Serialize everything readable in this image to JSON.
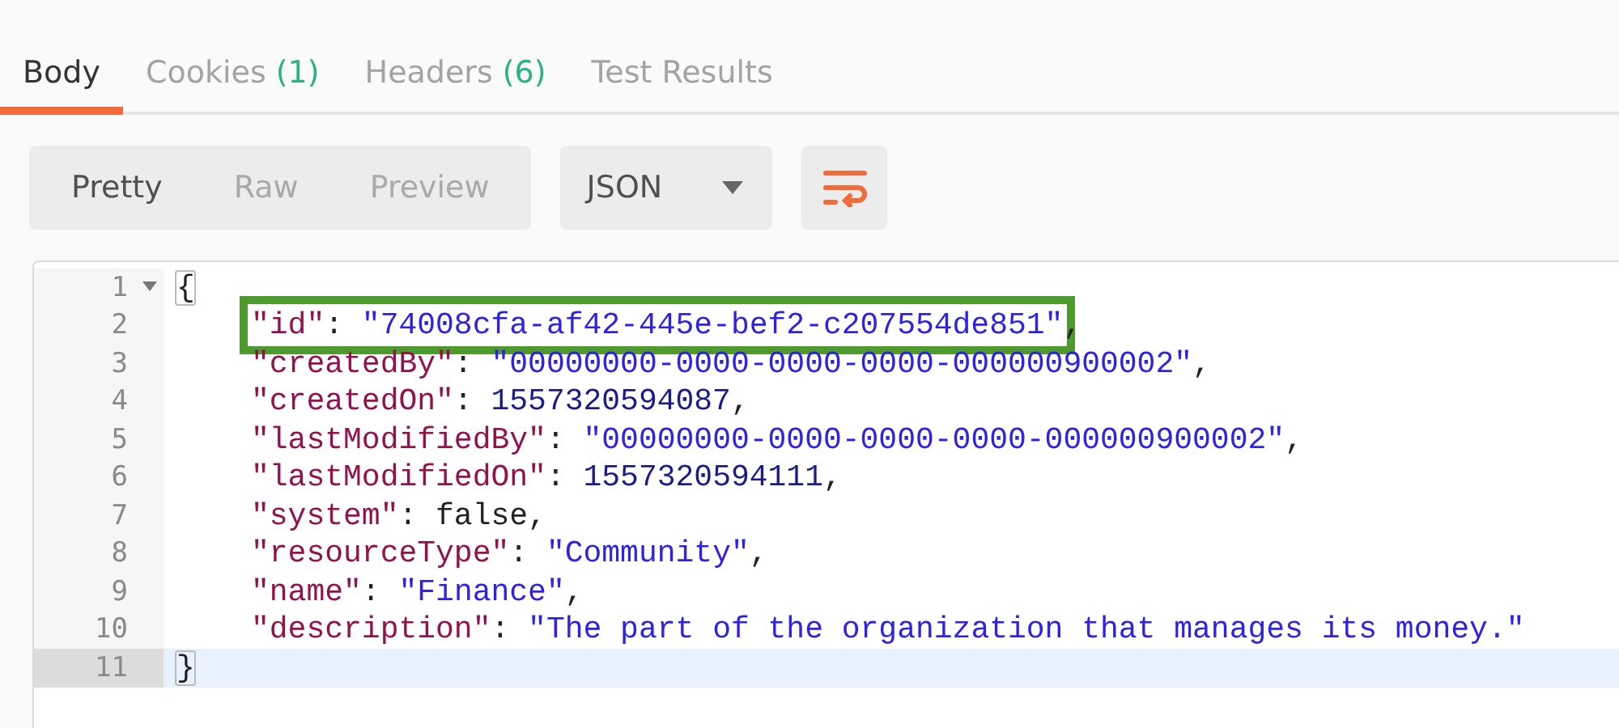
{
  "tabs": [
    {
      "label": "Body",
      "selected": true
    },
    {
      "label": "Cookies",
      "count": "(1)",
      "selected": false
    },
    {
      "label": "Headers",
      "count": "(6)",
      "selected": false
    },
    {
      "label": "Test Results",
      "selected": false
    }
  ],
  "view_modes": [
    {
      "label": "Pretty",
      "selected": true
    },
    {
      "label": "Raw",
      "selected": false
    },
    {
      "label": "Preview",
      "selected": false
    }
  ],
  "format_dropdown": {
    "value": "JSON"
  },
  "wrap_button": {
    "on": true
  },
  "editor": {
    "lines": [
      {
        "number": "1",
        "kind": "brace",
        "foldable": true,
        "current": false,
        "highlighted": false,
        "tokens": [
          {
            "kind": "punct",
            "text": "{"
          }
        ]
      },
      {
        "number": "2",
        "kind": "member",
        "foldable": false,
        "current": false,
        "highlighted": true,
        "tokens": [
          {
            "kind": "key",
            "text": "\"id\""
          },
          {
            "kind": "punct",
            "text": ": "
          },
          {
            "kind": "string",
            "text": "\"74008cfa-af42-445e-bef2-c207554de851\""
          },
          {
            "kind": "punct",
            "text": ","
          }
        ]
      },
      {
        "number": "3",
        "kind": "member",
        "foldable": false,
        "current": false,
        "highlighted": false,
        "tokens": [
          {
            "kind": "key",
            "text": "\"createdBy\""
          },
          {
            "kind": "punct",
            "text": ": "
          },
          {
            "kind": "string",
            "text": "\"00000000-0000-0000-0000-000000900002\""
          },
          {
            "kind": "punct",
            "text": ","
          }
        ]
      },
      {
        "number": "4",
        "kind": "member",
        "foldable": false,
        "current": false,
        "highlighted": false,
        "tokens": [
          {
            "kind": "key",
            "text": "\"createdOn\""
          },
          {
            "kind": "punct",
            "text": ": "
          },
          {
            "kind": "number",
            "text": "1557320594087"
          },
          {
            "kind": "punct",
            "text": ","
          }
        ]
      },
      {
        "number": "5",
        "kind": "member",
        "foldable": false,
        "current": false,
        "highlighted": false,
        "tokens": [
          {
            "kind": "key",
            "text": "\"lastModifiedBy\""
          },
          {
            "kind": "punct",
            "text": ": "
          },
          {
            "kind": "string",
            "text": "\"00000000-0000-0000-0000-000000900002\""
          },
          {
            "kind": "punct",
            "text": ","
          }
        ]
      },
      {
        "number": "6",
        "kind": "member",
        "foldable": false,
        "current": false,
        "highlighted": false,
        "tokens": [
          {
            "kind": "key",
            "text": "\"lastModifiedOn\""
          },
          {
            "kind": "punct",
            "text": ": "
          },
          {
            "kind": "number",
            "text": "1557320594111"
          },
          {
            "kind": "punct",
            "text": ","
          }
        ]
      },
      {
        "number": "7",
        "kind": "member",
        "foldable": false,
        "current": false,
        "highlighted": false,
        "tokens": [
          {
            "kind": "key",
            "text": "\"system\""
          },
          {
            "kind": "punct",
            "text": ": "
          },
          {
            "kind": "boolean",
            "text": "false"
          },
          {
            "kind": "punct",
            "text": ","
          }
        ]
      },
      {
        "number": "8",
        "kind": "member",
        "foldable": false,
        "current": false,
        "highlighted": false,
        "tokens": [
          {
            "kind": "key",
            "text": "\"resourceType\""
          },
          {
            "kind": "punct",
            "text": ": "
          },
          {
            "kind": "string",
            "text": "\"Community\""
          },
          {
            "kind": "punct",
            "text": ","
          }
        ]
      },
      {
        "number": "9",
        "kind": "member",
        "foldable": false,
        "current": false,
        "highlighted": false,
        "tokens": [
          {
            "kind": "key",
            "text": "\"name\""
          },
          {
            "kind": "punct",
            "text": ": "
          },
          {
            "kind": "string",
            "text": "\"Finance\""
          },
          {
            "kind": "punct",
            "text": ","
          }
        ]
      },
      {
        "number": "10",
        "kind": "member",
        "foldable": false,
        "current": false,
        "highlighted": false,
        "tokens": [
          {
            "kind": "key",
            "text": "\"description\""
          },
          {
            "kind": "punct",
            "text": ": "
          },
          {
            "kind": "string",
            "text": "\"The part of the organization that manages its money.\""
          }
        ]
      },
      {
        "number": "11",
        "kind": "brace",
        "foldable": false,
        "current": true,
        "highlighted": false,
        "tokens": [
          {
            "kind": "punct",
            "text": "}"
          }
        ]
      }
    ]
  }
}
